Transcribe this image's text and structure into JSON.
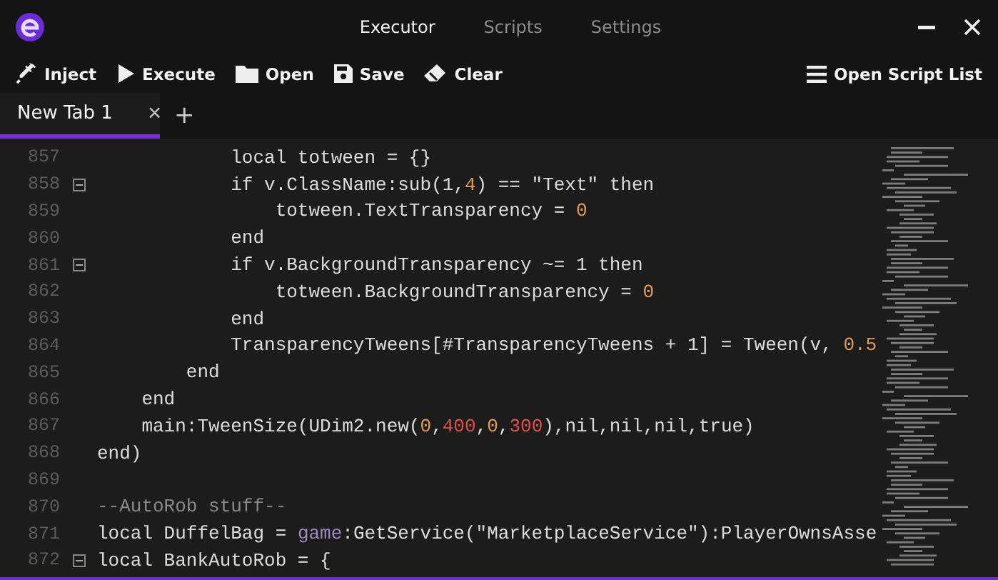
{
  "title_bar": {
    "nav_tabs": [
      {
        "label": "Executor",
        "selected": true
      },
      {
        "label": "Scripts",
        "selected": false
      },
      {
        "label": "Settings",
        "selected": false
      }
    ]
  },
  "toolbar": {
    "left": [
      {
        "label": "Inject",
        "kind": "syringe"
      },
      {
        "label": "Execute",
        "kind": "play"
      },
      {
        "label": "Open",
        "kind": "folder"
      },
      {
        "label": "Save",
        "kind": "floppy"
      },
      {
        "label": "Clear",
        "kind": "eraser"
      }
    ],
    "right": [
      {
        "label": "Open Script List",
        "kind": "list"
      }
    ]
  },
  "editor_tabs": [
    {
      "label": "New Tab 1",
      "close": "×",
      "selected": true
    }
  ],
  "new_tab": "+",
  "editor": {
    "lines": [
      {
        "number": "857",
        "fold": false,
        "tokens": [
          {
            "kind": "plain",
            "text": "            local totween = {}"
          }
        ]
      },
      {
        "number": "858",
        "fold": true,
        "tokens": [
          {
            "kind": "plain",
            "text": "            if v.ClassName:sub("
          },
          {
            "kind": "plain",
            "text": "1,"
          },
          {
            "kind": "number",
            "text": "4"
          },
          {
            "kind": "plain",
            "text": ") == \"Text\" then"
          }
        ]
      },
      {
        "number": "859",
        "fold": false,
        "tokens": [
          {
            "kind": "plain",
            "text": "                totween.TextTransparency = "
          },
          {
            "kind": "number",
            "text": "0"
          }
        ]
      },
      {
        "number": "860",
        "fold": false,
        "tokens": [
          {
            "kind": "plain",
            "text": "            end"
          }
        ]
      },
      {
        "number": "861",
        "fold": true,
        "tokens": [
          {
            "kind": "plain",
            "text": "            if v.BackgroundTransparency ~= 1 then"
          }
        ]
      },
      {
        "number": "862",
        "fold": false,
        "tokens": [
          {
            "kind": "plain",
            "text": "                totween.BackgroundTransparency = "
          },
          {
            "kind": "number",
            "text": "0"
          }
        ]
      },
      {
        "number": "863",
        "fold": false,
        "tokens": [
          {
            "kind": "plain",
            "text": "            end"
          }
        ]
      },
      {
        "number": "864",
        "fold": false,
        "tokens": [
          {
            "kind": "plain",
            "text": "            TransparencyTweens[#TransparencyTweens + 1] = Tween(v, "
          },
          {
            "kind": "number",
            "text": "0.5"
          }
        ]
      },
      {
        "number": "865",
        "fold": false,
        "tokens": [
          {
            "kind": "plain",
            "text": "        end"
          }
        ]
      },
      {
        "number": "866",
        "fold": false,
        "tokens": [
          {
            "kind": "plain",
            "text": "    end"
          }
        ]
      },
      {
        "number": "867",
        "fold": false,
        "tokens": [
          {
            "kind": "plain",
            "text": "    main:TweenSize(UDim2.new("
          },
          {
            "kind": "number",
            "text": "0"
          },
          {
            "kind": "plain",
            "text": ","
          },
          {
            "kind": "large_number",
            "text": "400"
          },
          {
            "kind": "plain",
            "text": ","
          },
          {
            "kind": "number",
            "text": "0"
          },
          {
            "kind": "plain",
            "text": ","
          },
          {
            "kind": "large_number",
            "text": "300"
          },
          {
            "kind": "plain",
            "text": "),nil,nil,nil,true)"
          }
        ]
      },
      {
        "number": "868",
        "fold": false,
        "tokens": [
          {
            "kind": "plain",
            "text": "end)"
          }
        ]
      },
      {
        "number": "869",
        "fold": false
      },
      {
        "number": "870",
        "fold": false,
        "tokens": [
          {
            "kind": "comment",
            "text": "--AutoRob stuff--"
          }
        ]
      },
      {
        "number": "871",
        "fold": false,
        "tokens": [
          {
            "kind": "plain",
            "text": "local DuffelBag = "
          },
          {
            "kind": "global",
            "text": "game"
          },
          {
            "kind": "plain",
            "text": ":GetService(\"MarketplaceService\"):PlayerOwnsAsse"
          }
        ]
      },
      {
        "number": "872",
        "fold": true,
        "tokens": [
          {
            "kind": "plain",
            "text": "local BankAutoRob = {"
          }
        ]
      }
    ]
  }
}
